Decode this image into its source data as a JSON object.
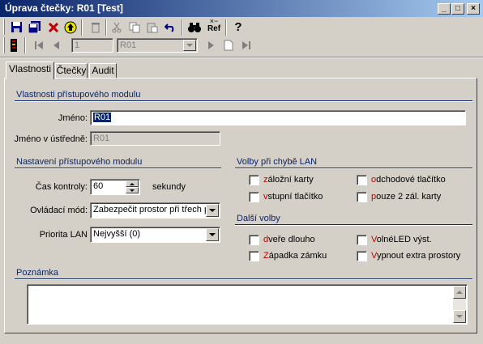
{
  "window": {
    "title": "Úprava čtečky: R01 [Test]"
  },
  "toolbar": {
    "record_number": "1",
    "record_combo": "R01",
    "icons": [
      "save-icon",
      "save-all-icon",
      "delete-icon",
      "refresh-icon",
      "trash-icon",
      "cut-icon",
      "copy-icon",
      "paste-icon",
      "undo-icon",
      "find-icon",
      "ref-icon",
      "help-icon",
      "reader-icon",
      "first-icon",
      "prev-icon",
      "next-icon",
      "new-icon",
      "last-icon"
    ],
    "ref_label": "Ref"
  },
  "tabs": [
    "Vlastnosti",
    "Čtečky",
    "Audit"
  ],
  "sections": {
    "module": "Vlastnosti přístupového modulu",
    "settings": "Nastavení přístupového modulu",
    "lan_errors": "Volby při chybě LAN",
    "other": "Další volby",
    "note": "Poznámka"
  },
  "fields": {
    "name_label": "Jméno:",
    "name_value": "R01",
    "central_label": "Jméno v ústředně:",
    "central_value": "R01",
    "timeout_label": "Čas kontroly:",
    "timeout_value": "60",
    "timeout_unit": "sekundy",
    "mode_label": "Ovládací mód:",
    "mode_value": "Zabezpečit prostor při třech p",
    "priority_label": "Priorita LAN",
    "priority_value": "Nejvyšší (0)"
  },
  "lan_options": [
    "záložní karty",
    "odchodové tlačítko",
    "vstupní tlačítko",
    "pouze 2 zál. karty"
  ],
  "other_options": [
    "dveře dlouho",
    "VolnéLED výst.",
    "Západka zámku",
    "Vypnout extra prostory"
  ]
}
